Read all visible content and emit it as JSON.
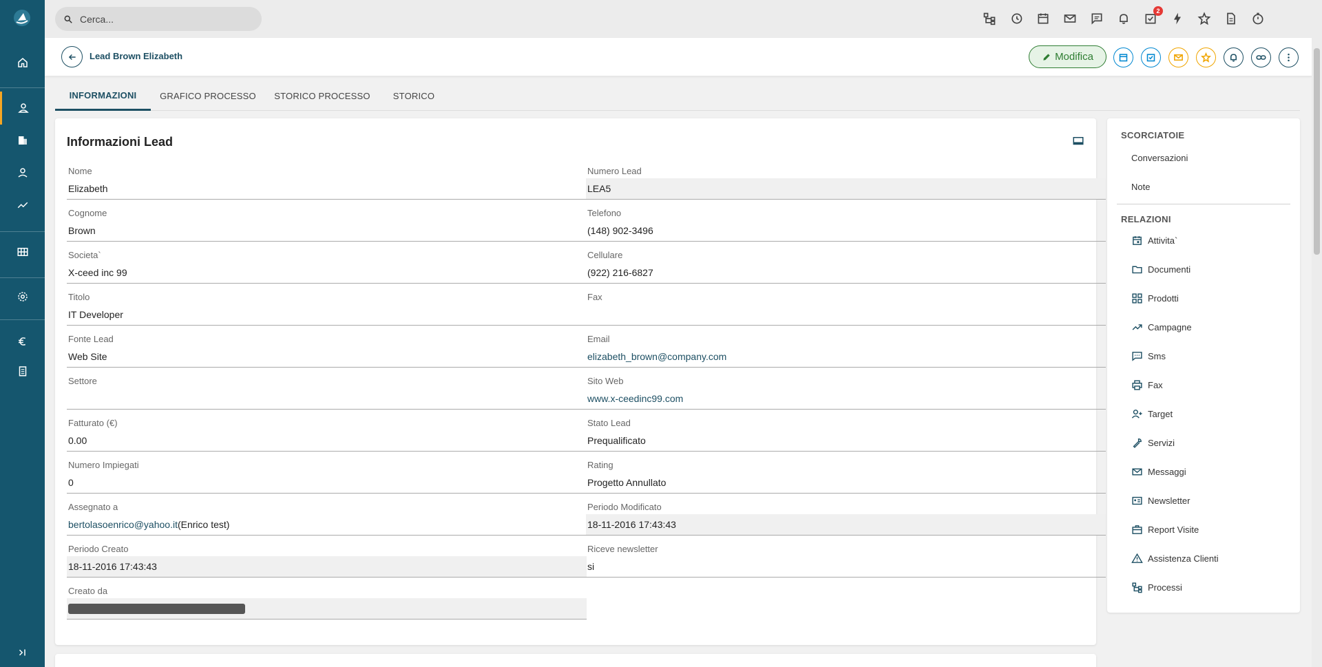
{
  "search": {
    "placeholder": "Cerca..."
  },
  "topbar": {
    "icons": [
      "process-icon",
      "history-icon",
      "calendar-icon",
      "mail-icon",
      "chat-icon",
      "bell-icon",
      "task-icon",
      "bolt-icon",
      "star-icon",
      "document-icon",
      "timer-icon"
    ],
    "task_badge": "2"
  },
  "sidebar": {
    "items": [
      "home-icon",
      "person-icon",
      "building-icon",
      "contact-icon",
      "trending-icon",
      "grid-icon",
      "gear-icon",
      "euro-icon",
      "clipboard-icon",
      "collapse-icon"
    ],
    "active_item": "person-icon"
  },
  "header": {
    "title": "Lead Brown Elizabeth",
    "edit_label": "Modifica"
  },
  "tabs": [
    {
      "label": "INFORMAZIONI",
      "active": true
    },
    {
      "label": "GRAFICO PROCESSO",
      "active": false
    },
    {
      "label": "STORICO PROCESSO",
      "active": false
    },
    {
      "label": "STORICO",
      "active": false
    }
  ],
  "card": {
    "title": "Informazioni Lead",
    "left": [
      {
        "label": "Nome",
        "value": "Elizabeth"
      },
      {
        "label": "Cognome",
        "value": "Brown"
      },
      {
        "label": "Societa`",
        "value": "X-ceed inc 99"
      },
      {
        "label": "Titolo",
        "value": "IT Developer"
      },
      {
        "label": "Fonte Lead",
        "value": "Web Site"
      },
      {
        "label": "Settore",
        "value": ""
      },
      {
        "label": "Fatturato (€)",
        "value": "0.00"
      },
      {
        "label": "Numero Impiegati",
        "value": "0"
      },
      {
        "label": "Assegnato a",
        "value": "bertolasoenrico@yahoo.it",
        "suffix": " (Enrico test)"
      },
      {
        "label": "Periodo Creato",
        "value": "18-11-2016 17:43:43"
      },
      {
        "label": "Creato da",
        "value": ""
      }
    ],
    "right": [
      {
        "label": "Numero Lead",
        "value": "LEA5"
      },
      {
        "label": "Telefono",
        "value": "(148) 902-3496"
      },
      {
        "label": "Cellulare",
        "value": "(922) 216-6827"
      },
      {
        "label": "Fax",
        "value": ""
      },
      {
        "label": "Email",
        "value": "elizabeth_brown@company.com"
      },
      {
        "label": "Sito Web",
        "value": "www.x-ceedinc99.com"
      },
      {
        "label": "Stato Lead",
        "value": "Prequalificato"
      },
      {
        "label": "Rating",
        "value": "Progetto Annullato"
      },
      {
        "label": "Periodo Modificato",
        "value": "18-11-2016 17:43:43"
      },
      {
        "label": "Riceve newsletter",
        "value": "si"
      }
    ]
  },
  "shortcuts": {
    "heading": "SCORCIATOIE",
    "items": [
      "Conversazioni",
      "Note"
    ]
  },
  "relations": {
    "heading": "RELAZIONI",
    "items": [
      {
        "label": "Attivita`",
        "icon": "calendar-icon"
      },
      {
        "label": "Documenti",
        "icon": "folder-icon"
      },
      {
        "label": "Prodotti",
        "icon": "products-icon"
      },
      {
        "label": "Campagne",
        "icon": "trending-icon"
      },
      {
        "label": "Sms",
        "icon": "sms-icon"
      },
      {
        "label": "Fax",
        "icon": "printer-icon"
      },
      {
        "label": "Target",
        "icon": "target-icon"
      },
      {
        "label": "Servizi",
        "icon": "wrench-icon"
      },
      {
        "label": "Messaggi",
        "icon": "mail-icon"
      },
      {
        "label": "Newsletter",
        "icon": "newsletter-icon"
      },
      {
        "label": "Report Visite",
        "icon": "briefcase-icon"
      },
      {
        "label": "Assistenza Clienti",
        "icon": "warning-icon"
      },
      {
        "label": "Processi",
        "icon": "process-icon"
      }
    ]
  },
  "colors": {
    "sidebar": "#15566e",
    "accent": "#1d4f63",
    "active_marker": "#f5a623",
    "edit_green": "#2e7d32",
    "calendar_blue": "#0288d1",
    "mail_orange": "#f0a500"
  }
}
